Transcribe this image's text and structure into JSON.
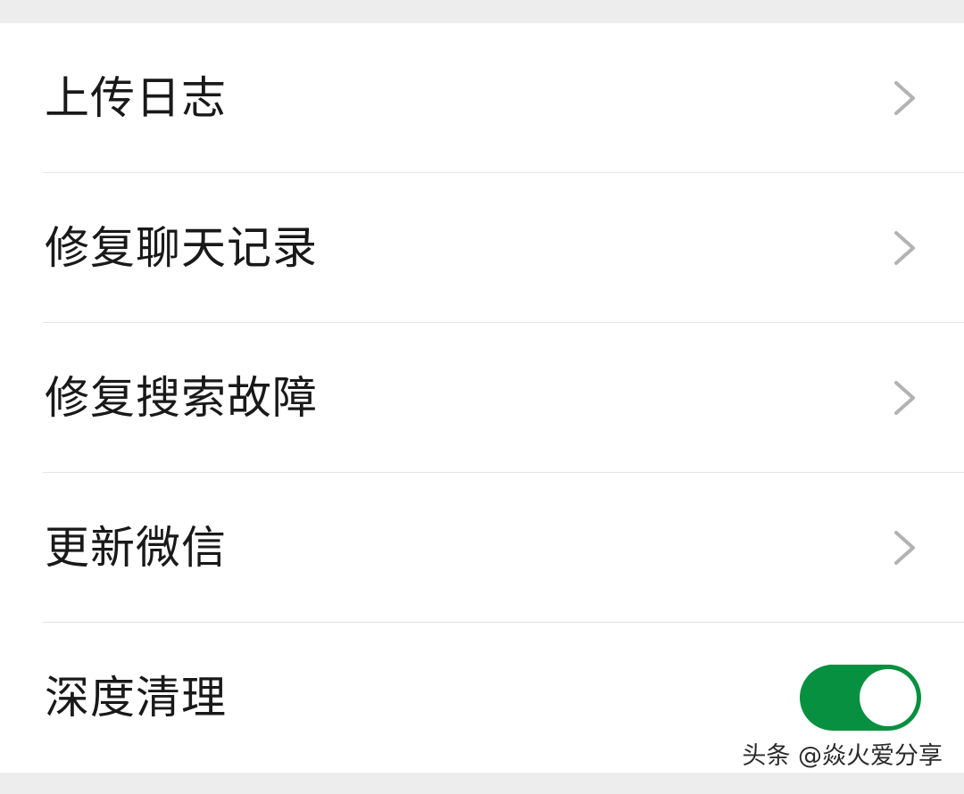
{
  "settings_list": {
    "items": [
      {
        "label": "上传日志",
        "control": "chevron"
      },
      {
        "label": "修复聊天记录",
        "control": "chevron"
      },
      {
        "label": "修复搜索故障",
        "control": "chevron"
      },
      {
        "label": "更新微信",
        "control": "chevron"
      },
      {
        "label": "深度清理",
        "control": "toggle",
        "toggle_on": true
      }
    ]
  },
  "watermark": {
    "text": "头条 @焱火爱分享"
  },
  "colors": {
    "toggle_on": "#07903f",
    "chevron": "#b2b2b2",
    "text": "#191919",
    "divider": "#e5e5e5",
    "background": "#ededed"
  },
  "icons": {
    "chevron": "chevron-right-icon"
  }
}
